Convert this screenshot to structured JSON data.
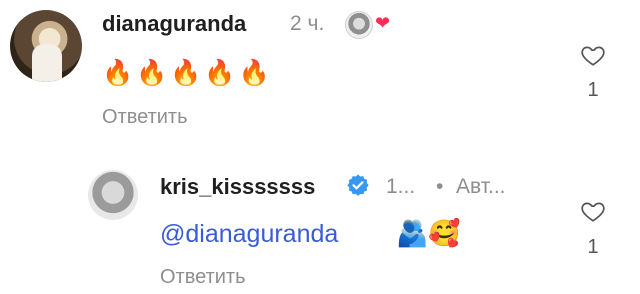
{
  "comments": [
    {
      "username": "dianaguranda",
      "time": "2 ч.",
      "author_like_icon": "heart-icon",
      "text_emojis": "🔥🔥🔥🔥🔥",
      "reply_label": "Ответить",
      "like_count": "1"
    },
    {
      "username": "kris_kisssssss",
      "verified": true,
      "meta_time": "1...",
      "meta_sep": "•",
      "meta_author": "Авт...",
      "mention": "@dianaguranda",
      "emojis": "🫂🥰",
      "reply_label": "Ответить",
      "like_count": "1"
    }
  ],
  "colors": {
    "accent_heart": "#ff2d55",
    "verified_blue": "#3897f0",
    "mention_blue": "#3b5bd6",
    "muted_text": "#8e8e8e"
  }
}
